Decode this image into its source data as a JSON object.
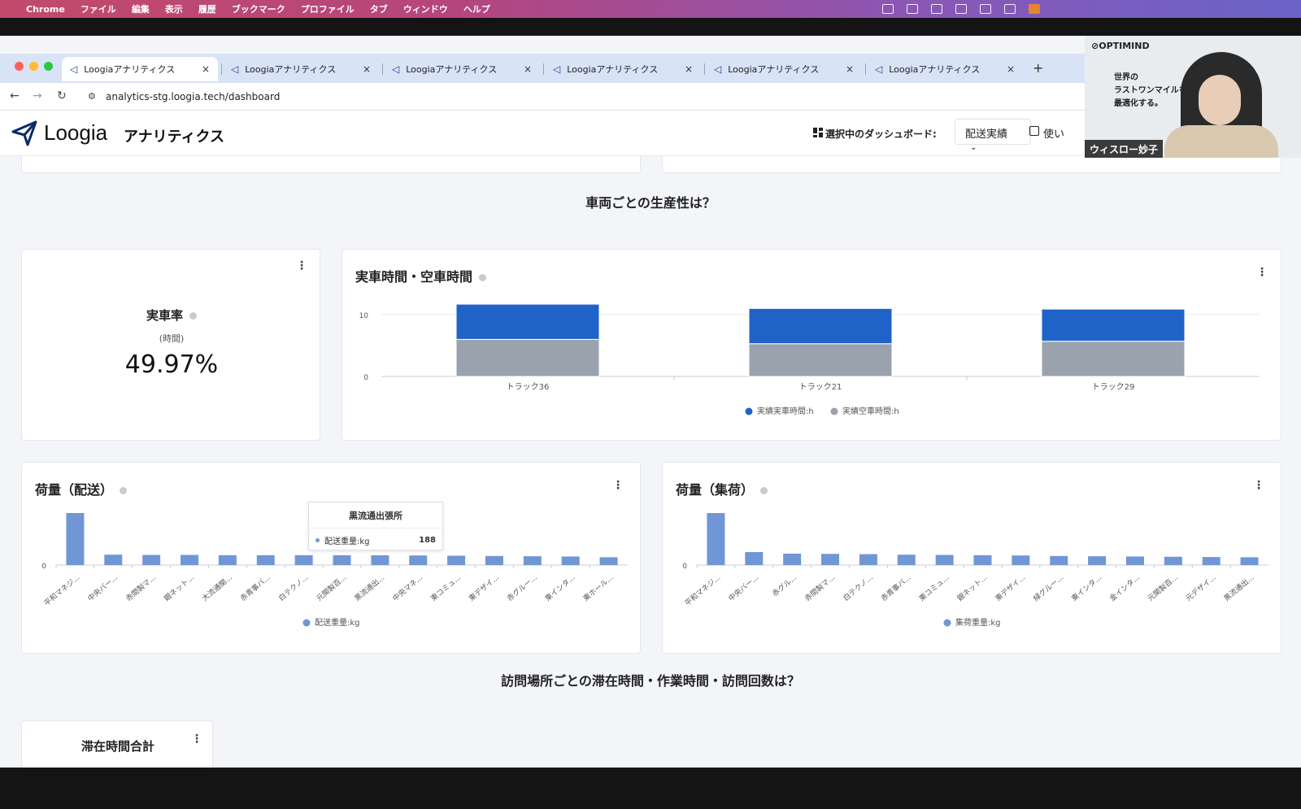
{
  "menubar": {
    "items": [
      "Chrome",
      "ファイル",
      "編集",
      "表示",
      "履歴",
      "ブックマーク",
      "プロファイル",
      "タブ",
      "ウィンドウ",
      "ヘルプ"
    ]
  },
  "tabs": [
    {
      "label": "Loogiaアナリティクス",
      "close": "×"
    },
    {
      "label": "Loogiaアナリティクス",
      "close": "×"
    },
    {
      "label": "Loogiaアナリティクス",
      "close": "×"
    },
    {
      "label": "Loogiaアナリティクス",
      "close": "×"
    },
    {
      "label": "Loogiaアナリティクス",
      "close": "×"
    },
    {
      "label": "Loogiaアナリティクス",
      "close": "×"
    }
  ],
  "new_tab": "+",
  "address": {
    "url": "analytics-stg.loogia.tech/dashboard"
  },
  "app": {
    "logo": "Loogia",
    "logo_sub": "アナリティクス",
    "dashboard_label": "選択中のダッシュボード:",
    "dashboard_value": "配送実績",
    "help": "使い"
  },
  "section1_title": "車両ごとの生産性は？",
  "rate_card": {
    "title": "実車率",
    "unit": "(時間)",
    "value": "49.97%"
  },
  "time_card": {
    "title": "実車時間・空車時間"
  },
  "delivery_card": {
    "title": "荷量（配送）",
    "tooltip": {
      "title": "黒流通出張所",
      "label": "配送重量:kg",
      "value": "188"
    }
  },
  "pickup_card": {
    "title": "荷量（集荷）"
  },
  "section2_title": "訪問場所ごとの滞在時間・作業時間・訪問回数は？",
  "stay_card": {
    "title": "滞在時間合計"
  },
  "video": {
    "brand": "OPTIMIND",
    "promo": [
      "世界の",
      "ラストワンマイルを",
      "最適化する。"
    ],
    "name": "ウィスロー妙子"
  },
  "colors": {
    "blue": "#1f63c8",
    "gray": "#9aa3ad",
    "light_blue": "#7196d6",
    "accent": "#0a2a6b"
  },
  "chart_data": [
    {
      "type": "bar",
      "title": "実車時間・空車時間",
      "stacked": true,
      "categories": [
        "トラック36",
        "トラック21",
        "トラック29"
      ],
      "series": [
        {
          "name": "実績空車時間:h",
          "values": [
            6.0,
            5.3,
            5.7
          ],
          "color": "#9aa3ad"
        },
        {
          "name": "実績実車時間:h",
          "values": [
            5.7,
            5.7,
            5.2
          ],
          "color": "#1f63c8"
        }
      ],
      "yticks": [
        "0",
        "10"
      ],
      "ylim": [
        0,
        10
      ],
      "legend": "bottom",
      "grid": true
    },
    {
      "type": "bar",
      "title": "荷量（配送）",
      "categories": [
        "平和マネジ...",
        "中央バー...",
        "赤間製マ...",
        "銀ネット...",
        "大流通関...",
        "赤青事バ...",
        "白テクノ...",
        "元関製百...",
        "黒流通出...",
        "中央マネ...",
        "東コミュ...",
        "東デザイ...",
        "赤グルー...",
        "東インタ...",
        "東ホール..."
      ],
      "series": [
        {
          "name": "配送重量:kg",
          "values": [
            1000,
            200,
            195,
            195,
            190,
            190,
            190,
            190,
            188,
            185,
            180,
            175,
            170,
            165,
            150
          ],
          "color": "#7196d6"
        }
      ],
      "yticks": [
        "0"
      ],
      "legend": "bottom"
    },
    {
      "type": "bar",
      "title": "荷量（集荷）",
      "categories": [
        "平和マネジ...",
        "中央バー...",
        "赤グル...",
        "赤間製マ...",
        "白テクノ...",
        "赤青事バ...",
        "東コミュ...",
        "銀ネット...",
        "東デザイ...",
        "緑グルー...",
        "東インタ...",
        "金インタ...",
        "元関製百...",
        "元デザイ...",
        "黒流通出..."
      ],
      "series": [
        {
          "name": "集荷重量:kg",
          "values": [
            1000,
            250,
            220,
            215,
            210,
            200,
            195,
            190,
            185,
            175,
            170,
            165,
            160,
            155,
            150
          ],
          "color": "#7196d6"
        }
      ],
      "yticks": [
        "0"
      ],
      "legend": "bottom"
    }
  ]
}
